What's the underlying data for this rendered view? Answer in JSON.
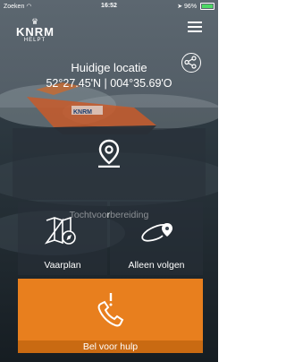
{
  "statusbar": {
    "carrier": "Zoeken",
    "time": "16:52",
    "battery": "96%",
    "battery_level": 0.96
  },
  "logo": {
    "brand": "KNRM",
    "tagline": "HELPT"
  },
  "location": {
    "title": "Huidige locatie",
    "coords": "52°27.45'N | 004°35.69'O"
  },
  "tiles": {
    "tochtvoorbereiding": "Tochtvoorbereiding",
    "vaarplan": "Vaarplan",
    "alleen_volgen": "Alleen volgen",
    "bel_voor_hulp": "Bel voor hulp"
  },
  "colors": {
    "accent": "#e87f1e",
    "accent_dark": "#c96a12"
  },
  "icons": [
    "wifi-icon",
    "menu-icon",
    "share-icon",
    "map-pin-icon",
    "map-compass-icon",
    "route-pin-icon",
    "phone-alert-icon"
  ]
}
